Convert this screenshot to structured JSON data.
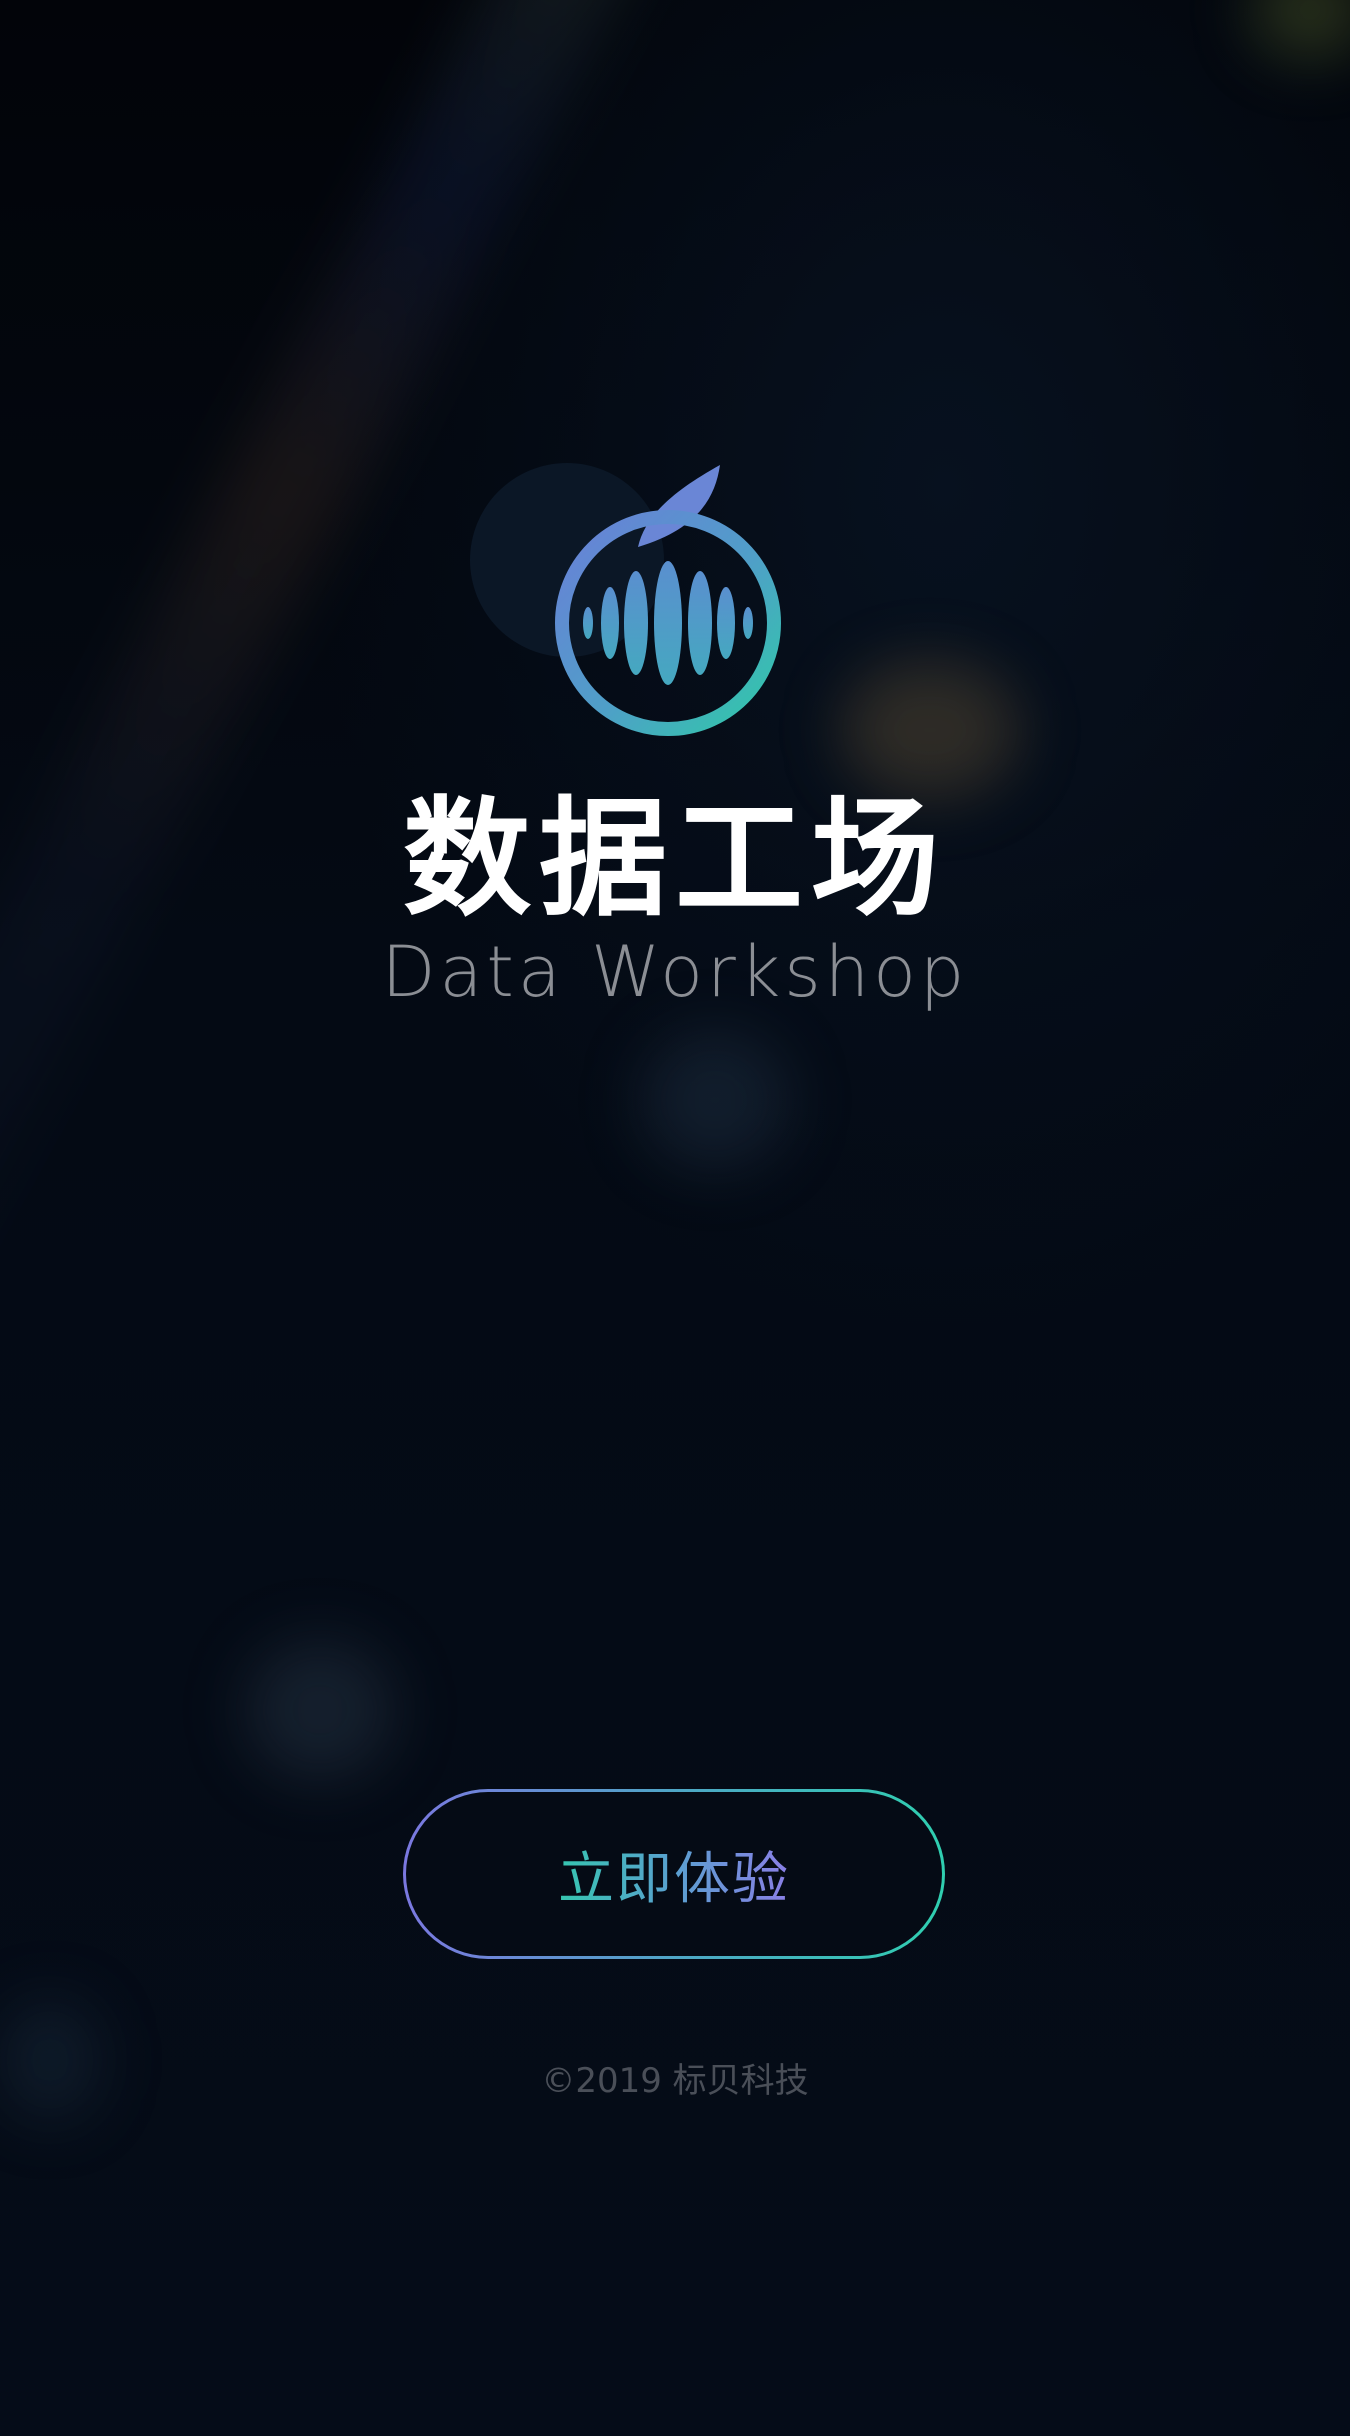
{
  "app": {
    "title_cn": "数据工场",
    "title_en": "Data Workshop",
    "logo_icon": "fruit-waveform-logo"
  },
  "cta": {
    "label": "立即体验"
  },
  "footer": {
    "copyright": "©2019 标贝科技"
  },
  "colors": {
    "background": "#040912",
    "accent_purple": "#7b78e0",
    "accent_teal": "#2fcfb0",
    "logo_blue": "#5b86d8",
    "title_text": "#ffffff",
    "subtitle_text": "#8b8e94",
    "footer_text": "#4a4f58"
  }
}
